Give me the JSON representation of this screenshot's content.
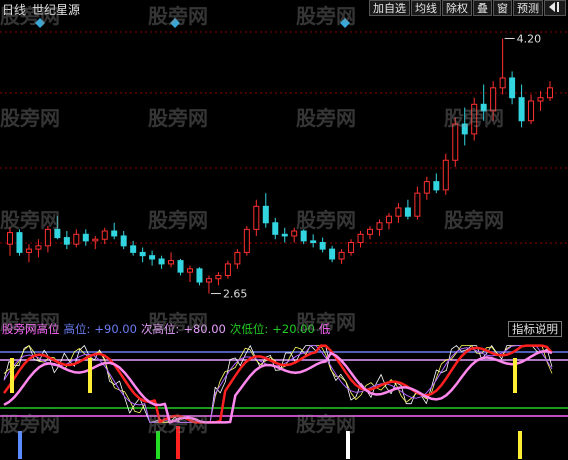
{
  "header": {
    "period": "日线",
    "stock_name": "世纪星源",
    "toolbar": [
      "加自选",
      "均线",
      "除权",
      "叠",
      "窗",
      "预测"
    ],
    "nav_icon": "left-right-arrow-icon"
  },
  "price_chart": {
    "high_label": "4.20",
    "low_label": "2.65",
    "ohlc": [
      [
        2.95,
        3.05,
        2.88,
        3.02
      ],
      [
        3.02,
        3.04,
        2.88,
        2.9
      ],
      [
        2.9,
        2.95,
        2.84,
        2.92
      ],
      [
        2.92,
        2.98,
        2.87,
        2.94
      ],
      [
        2.94,
        3.06,
        2.9,
        3.04
      ],
      [
        3.04,
        3.12,
        2.98,
        2.99
      ],
      [
        2.99,
        3.03,
        2.92,
        2.95
      ],
      [
        2.95,
        3.04,
        2.93,
        3.01
      ],
      [
        3.01,
        3.04,
        2.94,
        2.97
      ],
      [
        2.97,
        3.0,
        2.92,
        2.98
      ],
      [
        2.98,
        3.05,
        2.95,
        3.03
      ],
      [
        3.03,
        3.08,
        2.98,
        3.0
      ],
      [
        3.0,
        3.03,
        2.92,
        2.94
      ],
      [
        2.94,
        2.97,
        2.88,
        2.9
      ],
      [
        2.9,
        2.93,
        2.84,
        2.88
      ],
      [
        2.88,
        2.91,
        2.82,
        2.86
      ],
      [
        2.86,
        2.88,
        2.8,
        2.83
      ],
      [
        2.83,
        2.9,
        2.81,
        2.85
      ],
      [
        2.85,
        2.86,
        2.76,
        2.78
      ],
      [
        2.78,
        2.82,
        2.72,
        2.8
      ],
      [
        2.8,
        2.81,
        2.7,
        2.72
      ],
      [
        2.72,
        2.76,
        2.65,
        2.74
      ],
      [
        2.74,
        2.78,
        2.7,
        2.76
      ],
      [
        2.76,
        2.85,
        2.74,
        2.83
      ],
      [
        2.83,
        2.92,
        2.8,
        2.9
      ],
      [
        2.9,
        3.06,
        2.88,
        3.04
      ],
      [
        3.04,
        3.22,
        3.0,
        3.18
      ],
      [
        3.18,
        3.26,
        3.05,
        3.08
      ],
      [
        3.08,
        3.11,
        2.98,
        3.01
      ],
      [
        3.01,
        3.05,
        2.96,
        3.0
      ],
      [
        3.0,
        3.05,
        2.96,
        3.03
      ],
      [
        3.03,
        3.04,
        2.95,
        2.97
      ],
      [
        2.97,
        3.01,
        2.93,
        2.96
      ],
      [
        2.96,
        2.99,
        2.9,
        2.92
      ],
      [
        2.92,
        2.94,
        2.84,
        2.86
      ],
      [
        2.86,
        2.92,
        2.83,
        2.9
      ],
      [
        2.9,
        2.98,
        2.88,
        2.96
      ],
      [
        2.96,
        3.03,
        2.93,
        3.01
      ],
      [
        3.01,
        3.06,
        2.98,
        3.04
      ],
      [
        3.04,
        3.1,
        3.0,
        3.08
      ],
      [
        3.08,
        3.14,
        3.04,
        3.12
      ],
      [
        3.12,
        3.2,
        3.08,
        3.17
      ],
      [
        3.17,
        3.22,
        3.1,
        3.12
      ],
      [
        3.12,
        3.3,
        3.1,
        3.26
      ],
      [
        3.26,
        3.36,
        3.22,
        3.33
      ],
      [
        3.33,
        3.38,
        3.26,
        3.28
      ],
      [
        3.28,
        3.5,
        3.25,
        3.46
      ],
      [
        3.46,
        3.72,
        3.42,
        3.68
      ],
      [
        3.68,
        3.78,
        3.55,
        3.62
      ],
      [
        3.62,
        3.84,
        3.58,
        3.8
      ],
      [
        3.8,
        3.92,
        3.7,
        3.76
      ],
      [
        3.76,
        3.94,
        3.7,
        3.9
      ],
      [
        3.9,
        4.2,
        3.86,
        3.96
      ],
      [
        3.96,
        4.0,
        3.8,
        3.84
      ],
      [
        3.84,
        3.92,
        3.66,
        3.7
      ],
      [
        3.7,
        3.86,
        3.68,
        3.82
      ],
      [
        3.82,
        3.88,
        3.76,
        3.84
      ],
      [
        3.84,
        3.94,
        3.82,
        3.9
      ]
    ]
  },
  "indicator": {
    "name": "股旁网高位",
    "items": [
      {
        "label": "高位:",
        "value": "+90.00",
        "color": "#6a7cf0"
      },
      {
        "label": "次高位:",
        "value": "+80.00",
        "color": "#e8a0ff"
      },
      {
        "label": "次低位:",
        "value": "+20.00",
        "color": "#22cc22"
      },
      {
        "label": "低",
        "value": "",
        "color": "#ff66ff"
      }
    ],
    "help_label": "指标说明",
    "levels": [
      {
        "value": 90,
        "color": "#6a7cf0"
      },
      {
        "value": 80,
        "color": "#e8a0ff"
      },
      {
        "value": 20,
        "color": "#22cc22"
      },
      {
        "value": 10,
        "color": "#ff66ff"
      }
    ]
  },
  "watermark": "股旁网",
  "colors": {
    "up": "#ff3030",
    "down": "#33d6e0",
    "grid": "#8b0000",
    "marker": "#38a8d8"
  }
}
